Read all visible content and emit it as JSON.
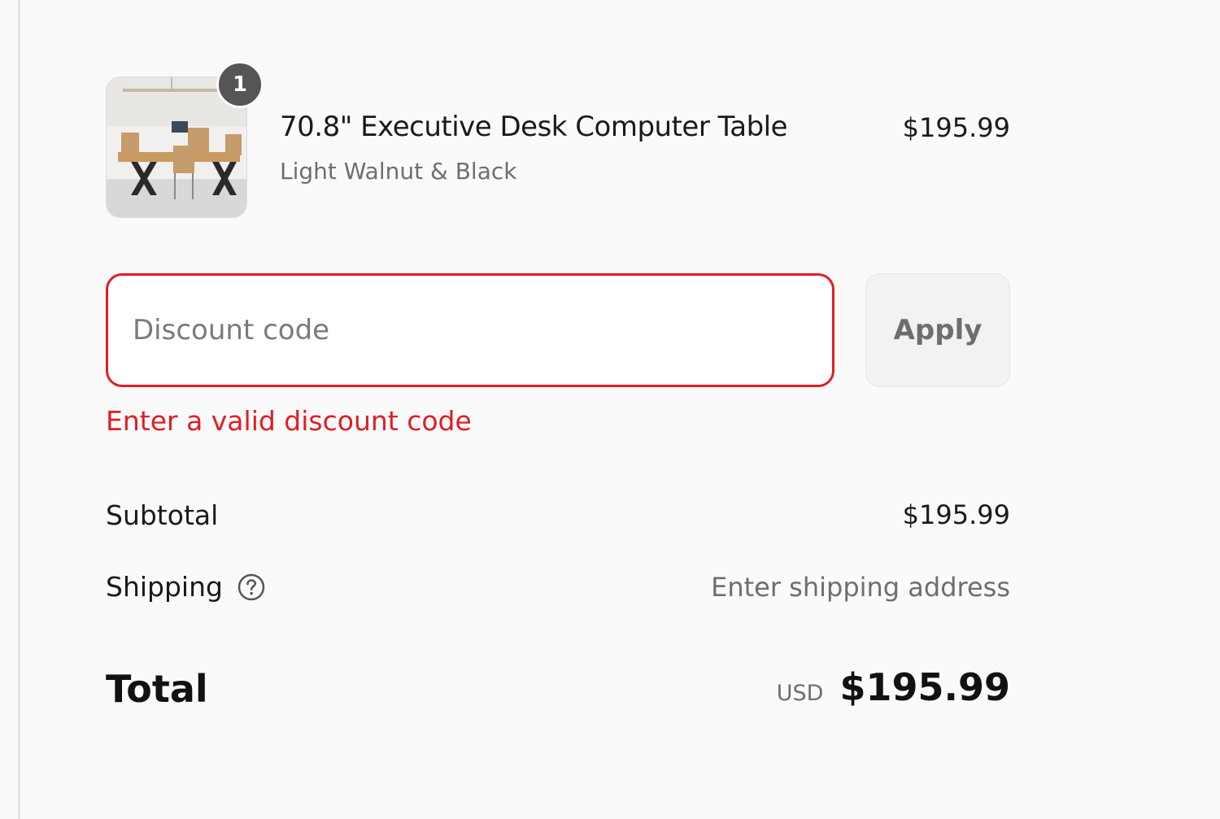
{
  "cart": {
    "item": {
      "quantity": "1",
      "name": "70.8\" Executive Desk Computer Table",
      "variant": "Light Walnut & Black",
      "price": "$195.99",
      "image_icon": "desk-product-image"
    }
  },
  "discount": {
    "placeholder": "Discount code",
    "value": "",
    "apply_label": "Apply",
    "error": "Enter a valid discount code",
    "error_color": "#e01e24"
  },
  "totals": {
    "subtotal_label": "Subtotal",
    "subtotal_value": "$195.99",
    "shipping_label": "Shipping",
    "shipping_value": "Enter shipping address",
    "shipping_icon": "help-circle-icon",
    "total_label": "Total",
    "currency": "USD",
    "total_value": "$195.99"
  }
}
